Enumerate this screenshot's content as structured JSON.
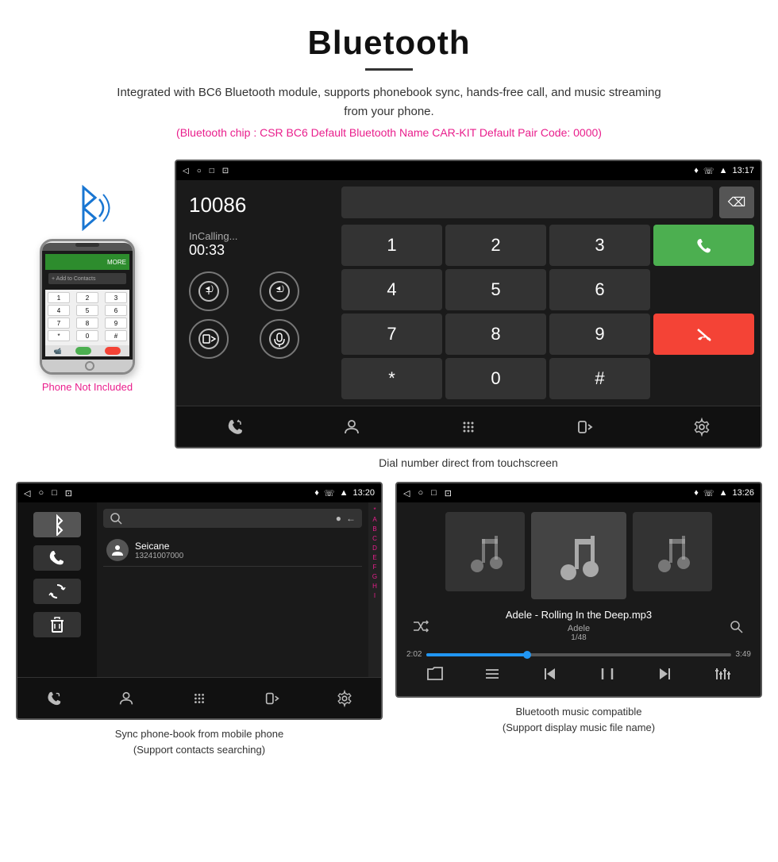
{
  "header": {
    "title": "Bluetooth",
    "description": "Integrated with BC6 Bluetooth module, supports phonebook sync, hands-free call, and music streaming from your phone.",
    "specs": "(Bluetooth chip : CSR BC6    Default Bluetooth Name CAR-KIT    Default Pair Code: 0000)"
  },
  "phone_side": {
    "not_included": "Phone Not Included"
  },
  "car_screen": {
    "status_bar": {
      "time": "13:17",
      "icons_left": [
        "◁",
        "○",
        "□",
        "⊡"
      ],
      "icons_right": [
        "♦",
        "☏",
        "▲"
      ]
    },
    "dial": {
      "number": "10086",
      "status": "InCalling...",
      "timer": "00:33",
      "keys": [
        "1",
        "2",
        "3",
        "*",
        "4",
        "5",
        "6",
        "0",
        "7",
        "8",
        "9",
        "#"
      ]
    },
    "bottom_nav": [
      "↿⇂",
      "⊙",
      "⊞",
      "⊡",
      "⚙"
    ]
  },
  "caption_main": "Dial number direct from touchscreen",
  "phonebook_screen": {
    "status_time": "13:20",
    "contact_name": "Seicane",
    "contact_number": "13241007000",
    "alpha_letters": [
      "*",
      "A",
      "B",
      "C",
      "D",
      "E",
      "F",
      "G",
      "H",
      "I"
    ],
    "bottom_nav": [
      "↿⇂",
      "⊙",
      "⊞",
      "⊡",
      "⚙"
    ]
  },
  "caption_phonebook_1": "Sync phone-book from mobile phone",
  "caption_phonebook_2": "(Support contacts searching)",
  "music_screen": {
    "status_time": "13:26",
    "track_name": "Adele - Rolling In the Deep.mp3",
    "artist": "Adele",
    "track_count": "1/48",
    "time_current": "2:02",
    "time_total": "3:49",
    "progress_percent": 33
  },
  "caption_music_1": "Bluetooth music compatible",
  "caption_music_2": "(Support display music file name)"
}
